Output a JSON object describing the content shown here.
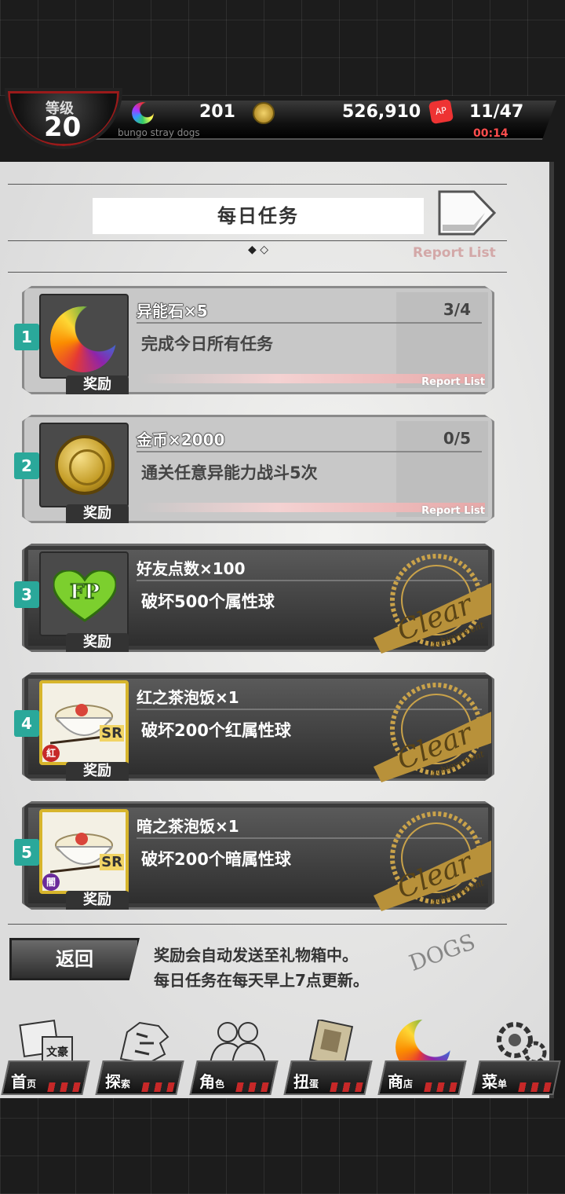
{
  "header": {
    "level_label": "等级",
    "level_value": "20",
    "subtitle": "bungo stray dogs",
    "stones": "201",
    "coins": "526,910",
    "stamina": "11/47",
    "stamina_timer": "00:14",
    "ap_label": "AP"
  },
  "panel": {
    "title": "每日任务",
    "report_list": "Report List",
    "page_dots": "◆ ◇"
  },
  "missions": [
    {
      "num": "1",
      "reward": "异能石×5",
      "desc": "完成今日所有任务",
      "progress": "3/4",
      "reward_label": "奖励",
      "report_tag": "Report List",
      "state": "active"
    },
    {
      "num": "2",
      "reward": "金币×2000",
      "desc": "通关任意异能力战斗5次",
      "progress": "0/5",
      "reward_label": "奖励",
      "report_tag": "Report List",
      "state": "active"
    },
    {
      "num": "3",
      "reward": "好友点数×100",
      "desc": "破坏500个属性球",
      "reward_label": "奖励",
      "state": "cleared",
      "icon_text": "FP"
    },
    {
      "num": "4",
      "reward": "红之茶泡饭×1",
      "desc": "破坏200个红属性球",
      "reward_label": "奖励",
      "state": "cleared",
      "element": "紅",
      "rarity": "SR"
    },
    {
      "num": "5",
      "reward": "暗之茶泡饭×1",
      "desc": "破坏200个暗属性球",
      "reward_label": "奖励",
      "state": "cleared",
      "element": "闇",
      "rarity": "SR"
    }
  ],
  "stamp": {
    "word": "Clear",
    "sub": "Achievement"
  },
  "footer": {
    "back": "返回",
    "note1": "奖励会自动发送至礼物箱中。",
    "note2": "每日任务在每天早上7点更新。",
    "deco": "DOGS"
  },
  "nav": [
    {
      "main": "首",
      "small": "页",
      "icon": "bungo-logo-icon"
    },
    {
      "main": "探",
      "small": "索",
      "icon": "tiger-icon"
    },
    {
      "main": "角",
      "small": "色",
      "icon": "people-icon"
    },
    {
      "main": "扭",
      "small": "蛋",
      "icon": "book-icon"
    },
    {
      "main": "商",
      "small": "店",
      "icon": "moon-stone-icon"
    },
    {
      "main": "菜",
      "small": "单",
      "icon": "gear-icon"
    }
  ],
  "nav_icon_text": "文豪",
  "colors": {
    "teal_badge": "#2aa89a",
    "gold": "#c9a24a",
    "timer": "#ff4d4d",
    "report": "#d3a8a8"
  }
}
